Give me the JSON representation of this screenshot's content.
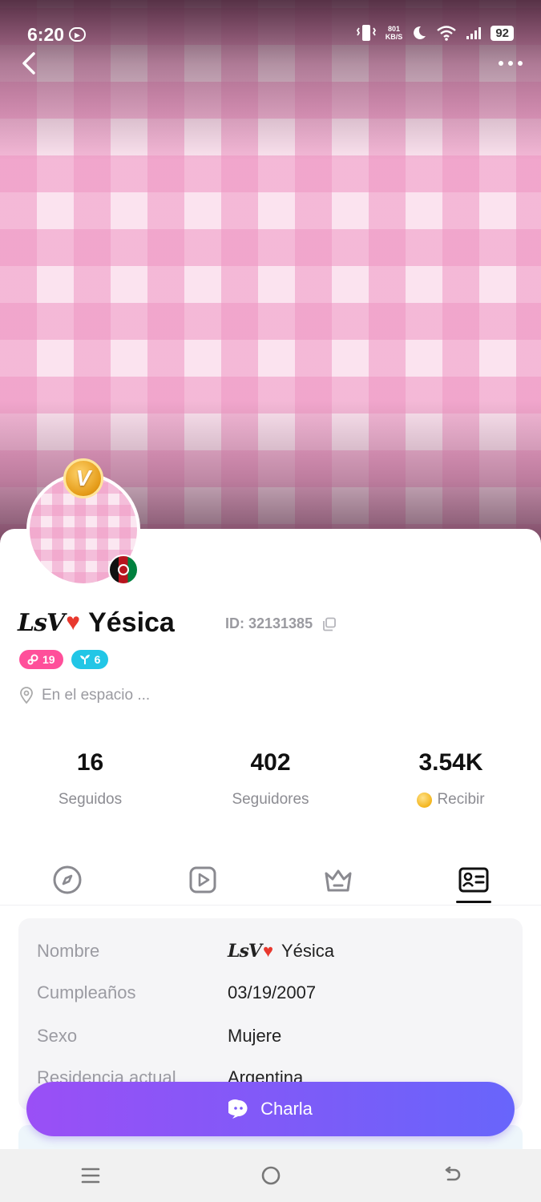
{
  "status_bar": {
    "time": "6:20",
    "net_speed_value": "801",
    "net_speed_unit": "KB/S",
    "battery": "92"
  },
  "profile": {
    "name_prefix": "LsV",
    "name": "Yésica",
    "id_text": "ID: 32131385",
    "level_badge": "19",
    "plant_badge": "6",
    "location": "En el espacio ..."
  },
  "stats": [
    {
      "value": "16",
      "label": "Seguidos"
    },
    {
      "value": "402",
      "label": "Seguidores"
    },
    {
      "value": "3.54K",
      "label": "Recibir"
    }
  ],
  "tabs": [
    {
      "icon": "compass-icon"
    },
    {
      "icon": "play-icon"
    },
    {
      "icon": "crown-icon"
    },
    {
      "icon": "profile-card-icon",
      "active": true
    }
  ],
  "info": {
    "rows": [
      {
        "label": "Nombre",
        "value_prefix": "LsV",
        "value": "Yésica"
      },
      {
        "label": "Cumpleaños",
        "value": "03/19/2007"
      },
      {
        "label": "Sexo",
        "value": "Mujere"
      },
      {
        "label": "Residencia actual",
        "value": "Argentina"
      }
    ]
  },
  "chat_button": {
    "label": "Charla"
  },
  "colors": {
    "accent_start": "#9a4ff6",
    "accent_end": "#6865fb",
    "level_badge": "#ff4f9a",
    "plant_badge": "#22c6e6",
    "cover_pink": "#f3a9cf"
  }
}
